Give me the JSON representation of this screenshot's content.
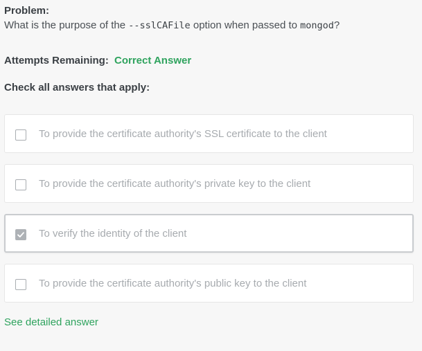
{
  "problem": {
    "heading": "Problem:",
    "question_prefix": "What is the purpose of the ",
    "option_code": "--sslCAFile",
    "question_middle": " option when passed to ",
    "program_code": "mongod",
    "question_suffix": "?"
  },
  "attempts": {
    "label": "Attempts Remaining:",
    "status": "Correct Answer"
  },
  "instructions": "Check all answers that apply:",
  "options": [
    {
      "label": "To provide the certificate authority's SSL certificate to the client",
      "checked": false
    },
    {
      "label": "To provide the certificate authority's private key to the client",
      "checked": false
    },
    {
      "label": "To verify the identity of the client",
      "checked": true
    },
    {
      "label": "To provide the certificate authority's public key to the client",
      "checked": false
    }
  ],
  "detail_link": "See detailed answer",
  "colors": {
    "accent_green": "#2fa35e",
    "option_text": "#a7abaf",
    "checked_box": "#aeb2b6"
  },
  "icons": {
    "checkmark": "checkmark-icon"
  }
}
